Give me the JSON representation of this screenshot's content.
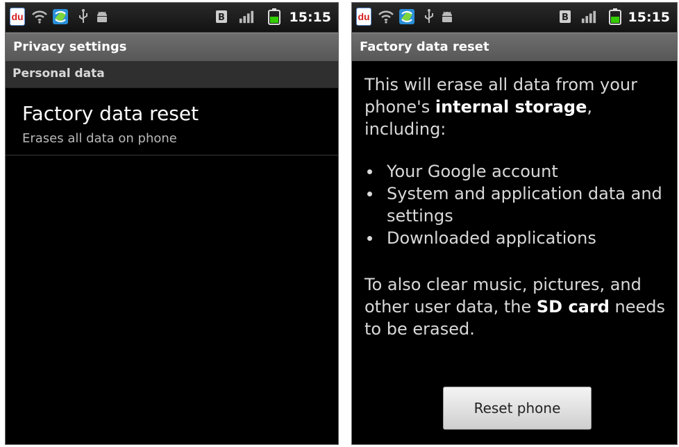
{
  "status_bar": {
    "time": "15:15",
    "icons": [
      "du-app-icon",
      "wifi-icon",
      "sync-app-icon",
      "usb-icon",
      "android-debug-icon",
      "notification-b-icon",
      "signal-icon",
      "battery-icon"
    ],
    "du_label": "du",
    "b_label": "B"
  },
  "left": {
    "title": "Privacy settings",
    "section": "Personal data",
    "item": {
      "title": "Factory data reset",
      "summary": "Erases all data on phone"
    }
  },
  "right": {
    "title": "Factory data reset",
    "para1": {
      "pre": "This will erase all data from your phone's ",
      "bold": "internal storage",
      "post": ", including:"
    },
    "bullets": [
      "Your Google account",
      "System and application data and settings",
      "Downloaded applications"
    ],
    "para2": {
      "pre": "To also clear music, pictures, and other user data, the ",
      "bold": "SD card",
      "post": " needs to be erased."
    },
    "button_label": "Reset phone"
  },
  "colors": {
    "background": "#000000",
    "title_bar": "#666666",
    "section_header": "#2f2f2f",
    "battery": "#33cc00",
    "du_red": "#d61f1f"
  }
}
